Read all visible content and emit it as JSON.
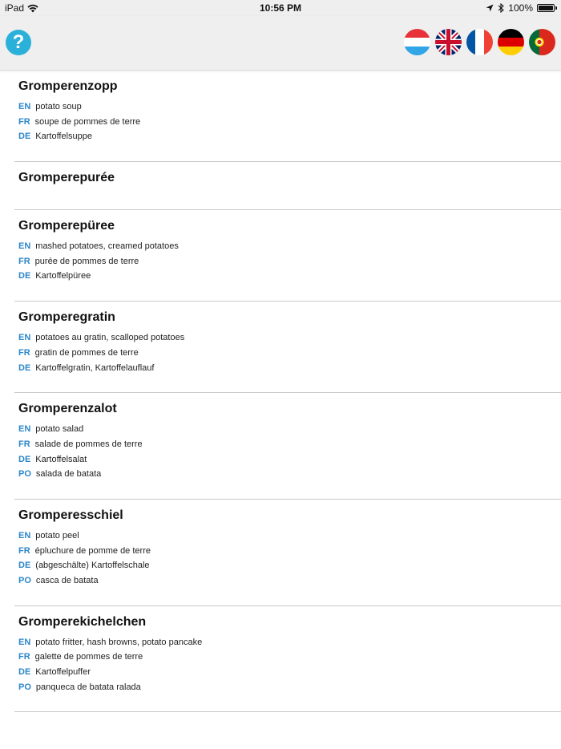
{
  "status_bar": {
    "device": "iPad",
    "time": "10:56 PM",
    "battery": "100%",
    "battery_level": 1.0
  },
  "header": {
    "help_label": "?",
    "flags": [
      {
        "name": "flag-luxembourg",
        "icon": "luxembourg-flag",
        "colors": [
          "#e8323a",
          "#ffffff",
          "#31a6e6"
        ]
      },
      {
        "name": "flag-united-kingdom",
        "icon": "uk-flag",
        "colors": [
          "#012169",
          "#ffffff",
          "#c8102e"
        ]
      },
      {
        "name": "flag-france",
        "icon": "france-flag",
        "colors": [
          "#0055a4",
          "#ffffff",
          "#ef4135"
        ]
      },
      {
        "name": "flag-germany",
        "icon": "germany-flag",
        "colors": [
          "#000000",
          "#dd0000",
          "#ffce00"
        ]
      },
      {
        "name": "flag-portugal",
        "icon": "portugal-flag",
        "colors": [
          "#046a38",
          "#da291c",
          "#ffe900"
        ]
      }
    ]
  },
  "accent_color": "#2a86c9",
  "entries": [
    {
      "title": "Gromperenzopp",
      "translations": [
        {
          "code": "EN",
          "text": "potato soup"
        },
        {
          "code": "FR",
          "text": "soupe de pommes de terre"
        },
        {
          "code": "DE",
          "text": "Kartoffelsuppe"
        }
      ]
    },
    {
      "title": "Gromperepurée",
      "translations": []
    },
    {
      "title": "Gromperepüree",
      "translations": [
        {
          "code": "EN",
          "text": "mashed potatoes, creamed potatoes"
        },
        {
          "code": "FR",
          "text": "purée de pommes de terre"
        },
        {
          "code": "DE",
          "text": "Kartoffelpüree"
        }
      ]
    },
    {
      "title": "Gromperegratin",
      "translations": [
        {
          "code": "EN",
          "text": "potatoes au gratin, scalloped potatoes"
        },
        {
          "code": "FR",
          "text": "gratin de pommes de terre"
        },
        {
          "code": "DE",
          "text": "Kartoffelgratin, Kartoffelauflauf"
        }
      ]
    },
    {
      "title": "Gromperenzalot",
      "translations": [
        {
          "code": "EN",
          "text": "potato salad"
        },
        {
          "code": "FR",
          "text": "salade de pommes de terre"
        },
        {
          "code": "DE",
          "text": "Kartoffelsalat"
        },
        {
          "code": "PO",
          "text": "salada de batata"
        }
      ]
    },
    {
      "title": "Gromperesschiel",
      "translations": [
        {
          "code": "EN",
          "text": "potato peel"
        },
        {
          "code": "FR",
          "text": "épluchure de pomme de terre"
        },
        {
          "code": "DE",
          "text": "(abgeschälte) Kartoffelschale"
        },
        {
          "code": "PO",
          "text": "casca de batata"
        }
      ]
    },
    {
      "title": "Gromperekichelchen",
      "translations": [
        {
          "code": "EN",
          "text": "potato fritter, hash browns, potato pancake"
        },
        {
          "code": "FR",
          "text": "galette de pommes de terre"
        },
        {
          "code": "DE",
          "text": "Kartoffelpuffer"
        },
        {
          "code": "PO",
          "text": "panqueca de batata ralada"
        }
      ]
    }
  ]
}
